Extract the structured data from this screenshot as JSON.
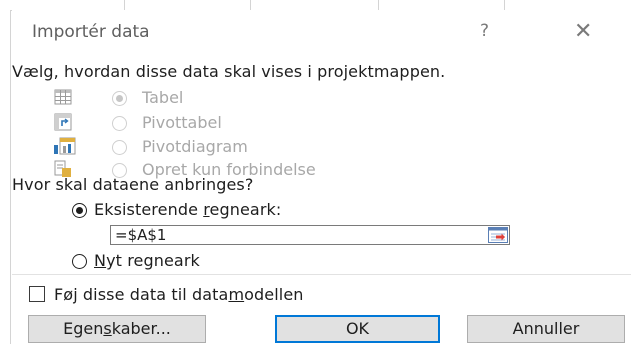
{
  "dialog": {
    "title": "Importér data",
    "help_label": "?",
    "close_label": "✕"
  },
  "view_section": {
    "heading": "Vælg, hvordan disse data skal vises i projektmappen.",
    "options": [
      {
        "label": "Tabel",
        "icon": "table-icon",
        "selected": true,
        "enabled": false
      },
      {
        "label": "Pivottabel",
        "icon": "pivottable-icon",
        "selected": false,
        "enabled": false
      },
      {
        "label": "Pivotdiagram",
        "icon": "pivotchart-icon",
        "selected": false,
        "enabled": false
      },
      {
        "label": "Opret kun forbindelse",
        "icon": "connection-only-icon",
        "selected": false,
        "enabled": false
      }
    ]
  },
  "placement_section": {
    "heading": "Hvor skal dataene anbringes?",
    "existing_sheet_pre": "Eksisterende ",
    "existing_sheet_accel": "r",
    "existing_sheet_post": "egneark:",
    "existing_sheet_selected": true,
    "cell_reference_value": "=$A$1",
    "new_sheet_accel": "N",
    "new_sheet_post": "yt regneark",
    "new_sheet_selected": false
  },
  "data_model": {
    "label_pre": "Føj disse data til data",
    "label_accel": "m",
    "label_post": "odellen",
    "checked": false
  },
  "buttons": {
    "properties_pre": "Egen",
    "properties_accel": "s",
    "properties_post": "kaber...",
    "ok_label": "OK",
    "cancel_label": "Annuller"
  },
  "colors": {
    "accent": "#0078d7",
    "button_face": "#e1e1e1",
    "disabled_text": "#a8a8a8"
  }
}
